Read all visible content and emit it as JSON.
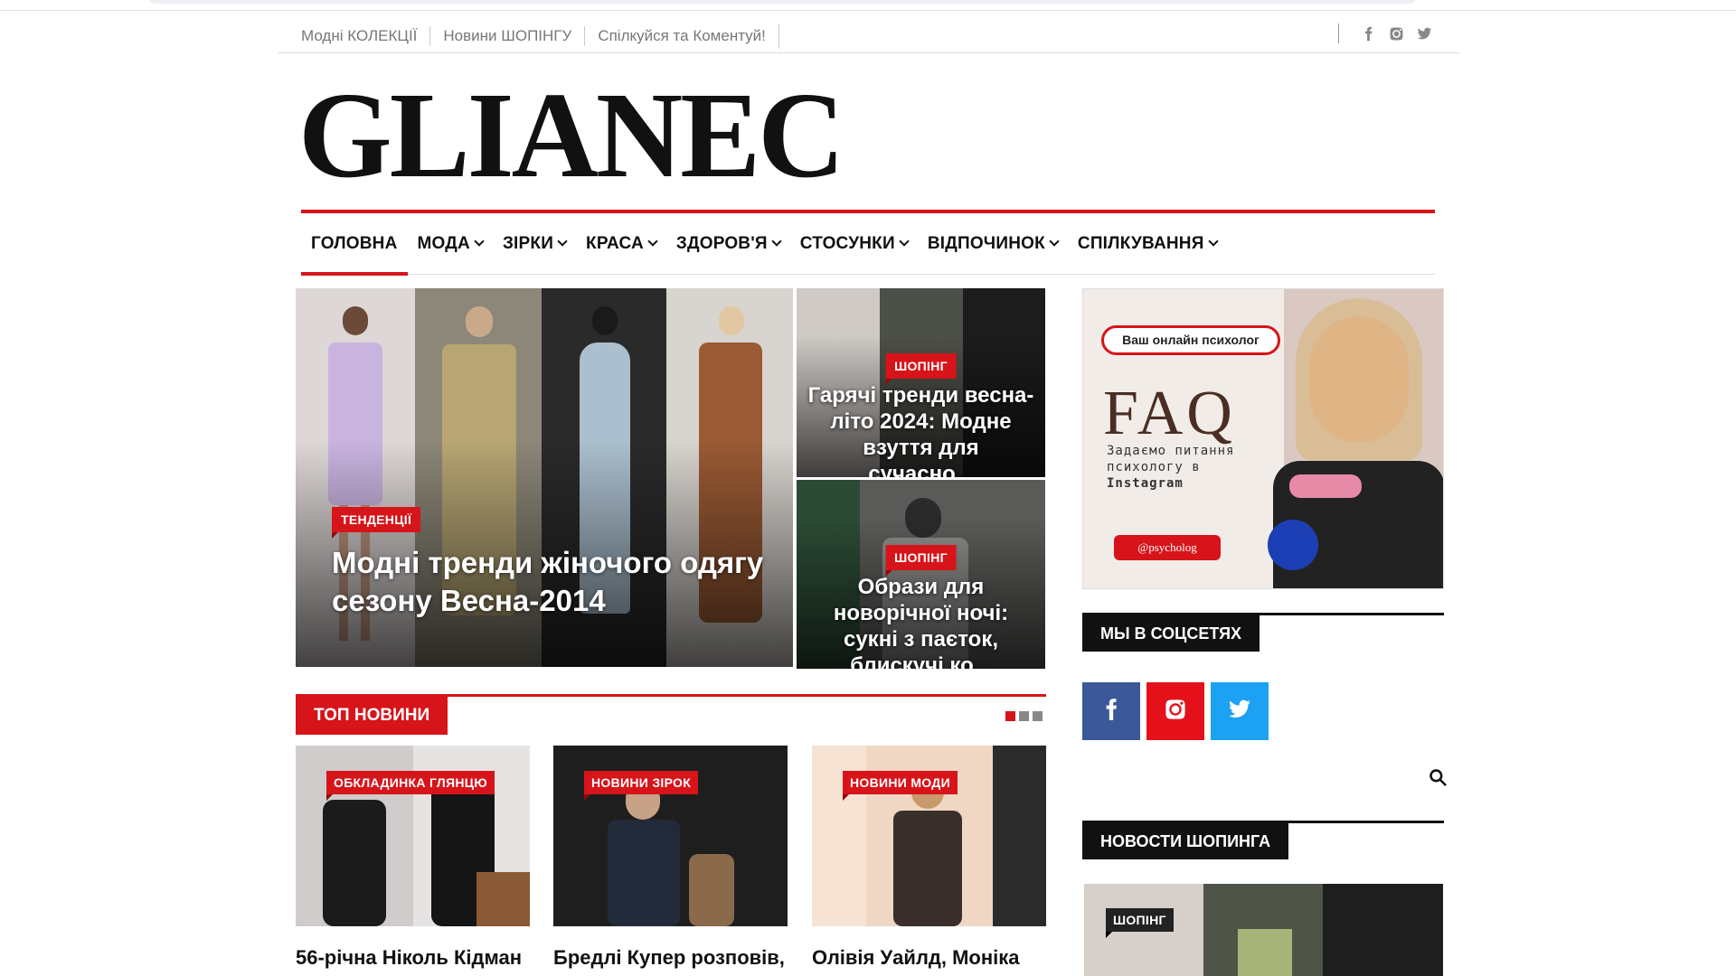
{
  "top_links": [
    "Модні КОЛЕКЦІЇ",
    "Новини ШОПІНГУ",
    "Спілкуйся та Коментуй!"
  ],
  "top_social_icons": [
    "facebook-icon",
    "instagram-icon",
    "twitter-icon"
  ],
  "logo": "GLIANEC",
  "nav": [
    {
      "label": "ГОЛОВНА",
      "dropdown": false,
      "active": true
    },
    {
      "label": "МОДА",
      "dropdown": true
    },
    {
      "label": "ЗІРКИ",
      "dropdown": true
    },
    {
      "label": "КРАСА",
      "dropdown": true
    },
    {
      "label": "ЗДОРОВ'Я",
      "dropdown": true
    },
    {
      "label": "СТОСУНКИ",
      "dropdown": true
    },
    {
      "label": "ВІДПОЧИНОК",
      "dropdown": true
    },
    {
      "label": "СПІЛКУВАННЯ",
      "dropdown": true
    }
  ],
  "hero": {
    "main": {
      "badge": "ТЕНДЕНЦІЇ",
      "title": "Модні тренди жіночого одягу сезону Весна-2014"
    },
    "side_top": {
      "badge": "ШОПІНГ",
      "title": "Гарячі тренди весна-літо 2024: Модне взуття для сучасно..."
    },
    "side_bottom": {
      "badge": "ШОПІНГ",
      "title": "Образи для новорічної ночі: сукні з паєток, блискучі ко..."
    }
  },
  "top_news": {
    "heading": "ТОП НОВИНИ",
    "cards": [
      {
        "badge": "ОБКЛАДИНКА ГЛЯНЦЮ",
        "title": "56-річна Ніколь Кідман"
      },
      {
        "badge": "НОВИНИ ЗІРОК",
        "title": "Бредлі Купер розповів,"
      },
      {
        "badge": "НОВИНИ МОДИ",
        "title": "Олівія Уайлд, Моніка"
      }
    ]
  },
  "ad": {
    "pill": "Ваш онлайн психолог",
    "faq": "FAQ",
    "sub_lines": [
      "Задаємо питання",
      "психологу в"
    ],
    "sub_bold": "Instagram",
    "handle": "@psycholog"
  },
  "sidebar": {
    "social_heading": "МЫ В СОЦСЕТЯХ",
    "social_buttons": [
      {
        "icon": "facebook-icon",
        "color": "#3b5998"
      },
      {
        "icon": "instagram-icon",
        "color": "#e4111b"
      },
      {
        "icon": "twitter-icon",
        "color": "#1da1f2"
      }
    ],
    "shop_heading": "НОВОСТИ ШОПИНГА",
    "shop_badge": "ШОПІНГ"
  },
  "colors": {
    "accent": "#d7141a",
    "dark": "#111111"
  }
}
